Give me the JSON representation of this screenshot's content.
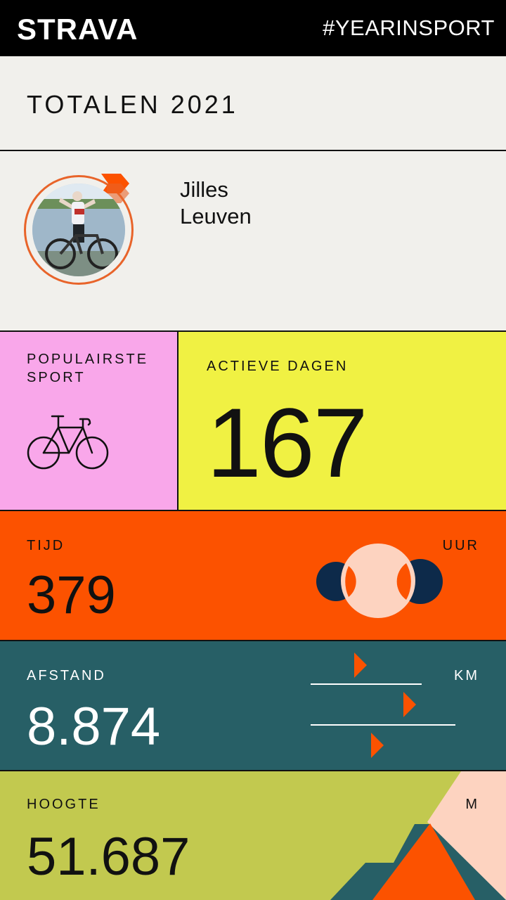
{
  "header": {
    "brand": "STRAVA",
    "hashtag": "#YEARINSPORT"
  },
  "section": {
    "title": "TOTALEN 2021"
  },
  "profile": {
    "first_name": "Jilles",
    "last_name": "Leuven"
  },
  "stats": {
    "popular_sport_label_1": "POPULAIRSTE",
    "popular_sport_label_2": "SPORT",
    "popular_sport_icon": "bicycle-icon",
    "active_days_label": "ACTIEVE DAGEN",
    "active_days_value": "167",
    "time_label": "TIJD",
    "time_value": "379",
    "time_unit": "UUR",
    "distance_label": "AFSTAND",
    "distance_value": "8.874",
    "distance_unit": "KM",
    "elevation_label": "HOOGTE",
    "elevation_value": "51.687",
    "elevation_unit": "M"
  },
  "colors": {
    "strava_orange": "#fc5200",
    "pink": "#f9a7ea",
    "yellow": "#f0f143",
    "teal": "#275f66",
    "olive": "#c2c94f",
    "peach": "#fdd3c0",
    "navy": "#0d2a4a"
  }
}
